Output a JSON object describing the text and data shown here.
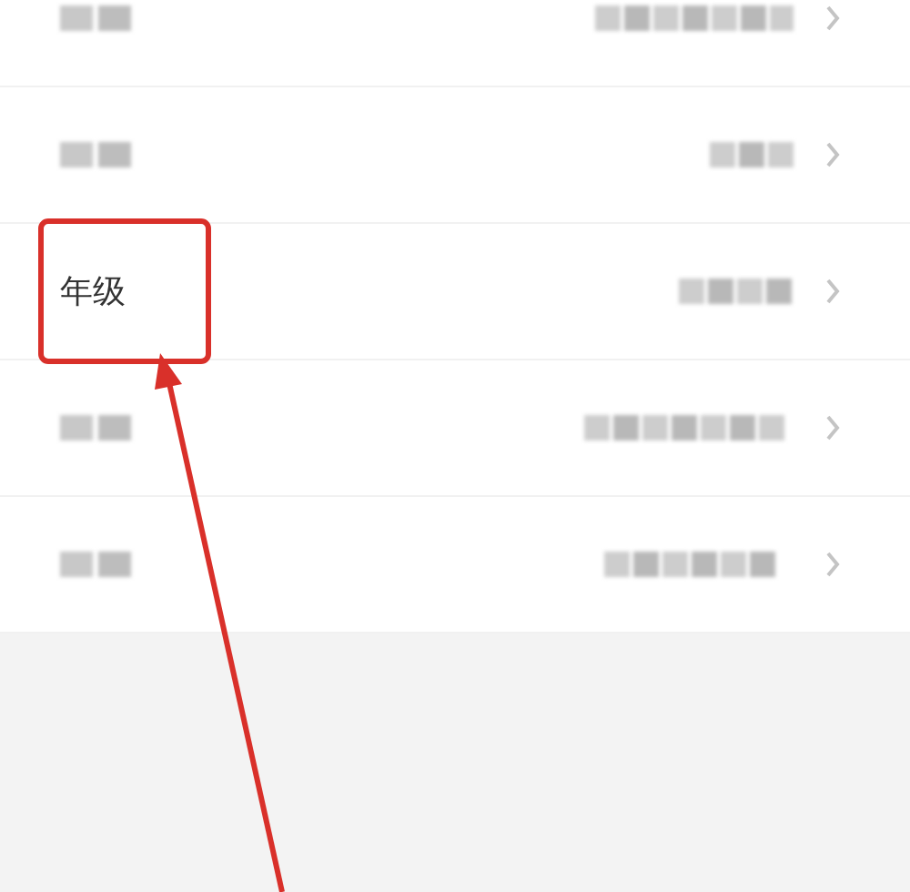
{
  "rows": [
    {
      "kind": "blurred",
      "highlighted": false
    },
    {
      "kind": "blurred",
      "highlighted": false
    },
    {
      "kind": "labeled",
      "label": "年级",
      "highlighted": true
    },
    {
      "kind": "blurred",
      "highlighted": false
    },
    {
      "kind": "blurred",
      "highlighted": false
    }
  ],
  "annotation": {
    "kind": "arrow"
  }
}
